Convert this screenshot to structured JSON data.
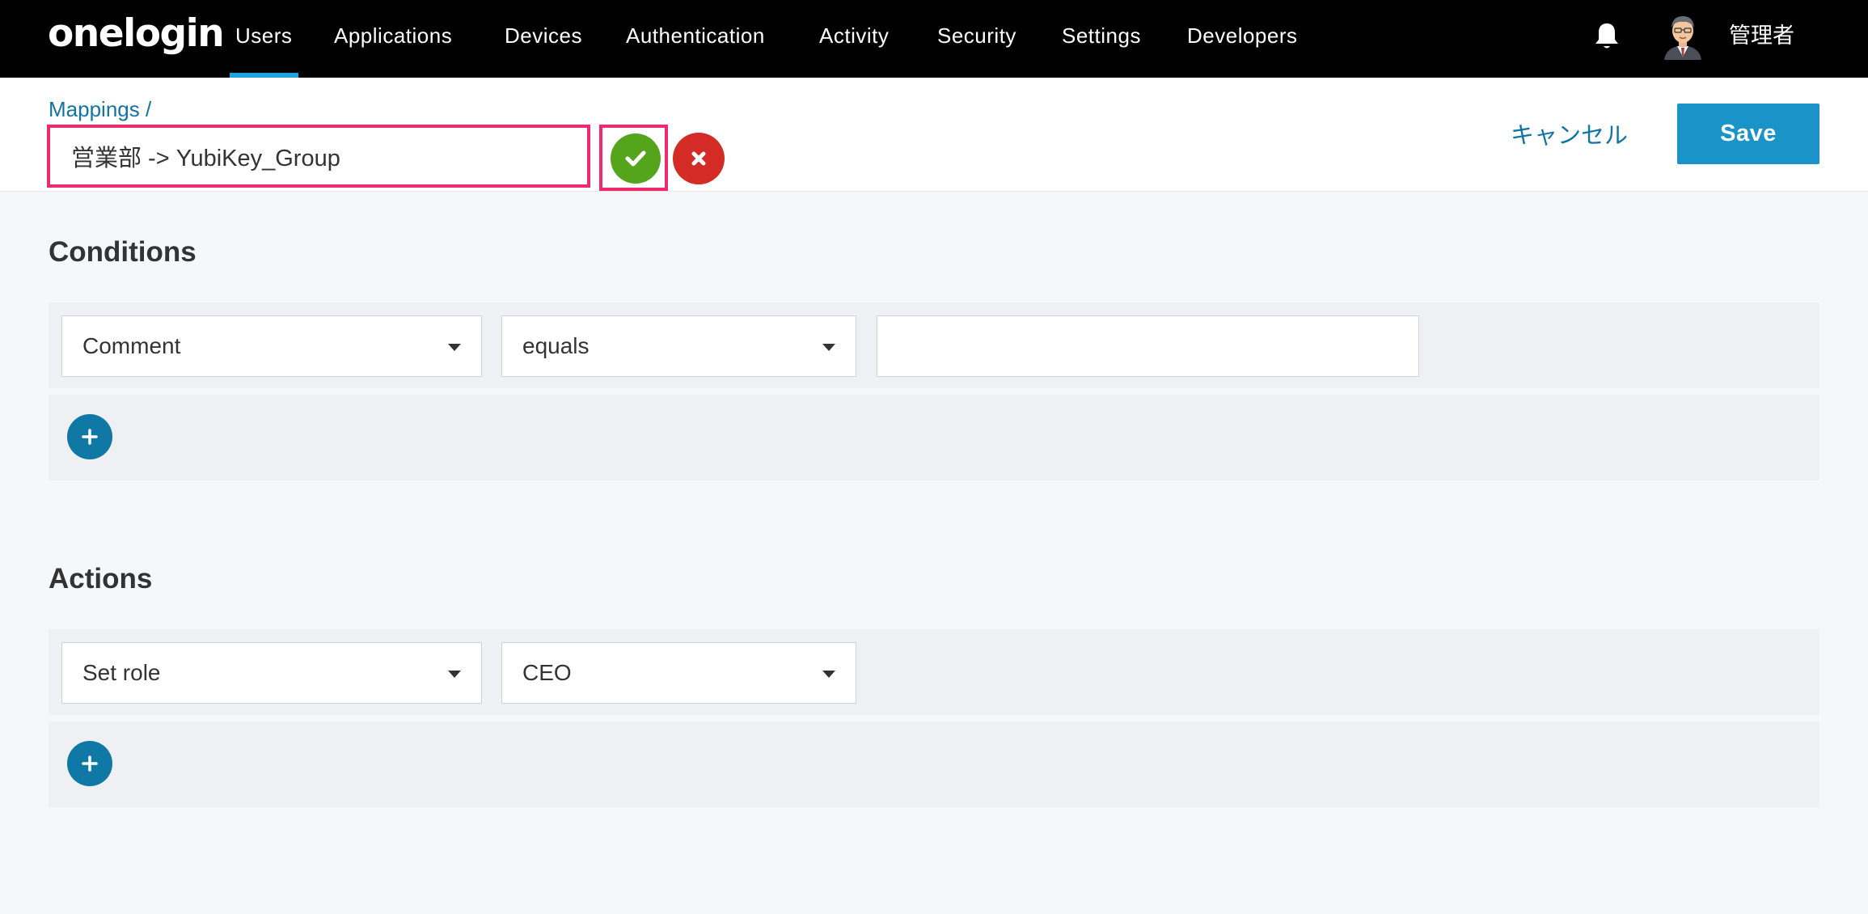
{
  "nav": {
    "logo": "onelogin",
    "items": [
      {
        "label": "Users",
        "active": true
      },
      {
        "label": "Applications",
        "active": false
      },
      {
        "label": "Devices",
        "active": false
      },
      {
        "label": "Authentication",
        "active": false
      },
      {
        "label": "Activity",
        "active": false
      },
      {
        "label": "Security",
        "active": false
      },
      {
        "label": "Settings",
        "active": false
      },
      {
        "label": "Developers",
        "active": false
      }
    ],
    "notification_icon": "bell-icon",
    "user_name": "管理者"
  },
  "header": {
    "breadcrumb": "Mappings /",
    "mapping_name": "営業部 -> YubiKey_Group",
    "cancel_label": "キャンセル",
    "save_label": "Save"
  },
  "conditions": {
    "title": "Conditions",
    "rows": [
      {
        "field": "Comment",
        "operator": "equals",
        "value": ""
      }
    ]
  },
  "actions": {
    "title": "Actions",
    "rows": [
      {
        "action": "Set role",
        "value": "CEO"
      }
    ]
  },
  "colors": {
    "accent": "#1fa5dd",
    "save_button": "#1a93c9",
    "confirm": "#55a51c",
    "discard": "#d42b26",
    "highlight": "#ee2b6f",
    "add_button": "#0f78a4"
  }
}
